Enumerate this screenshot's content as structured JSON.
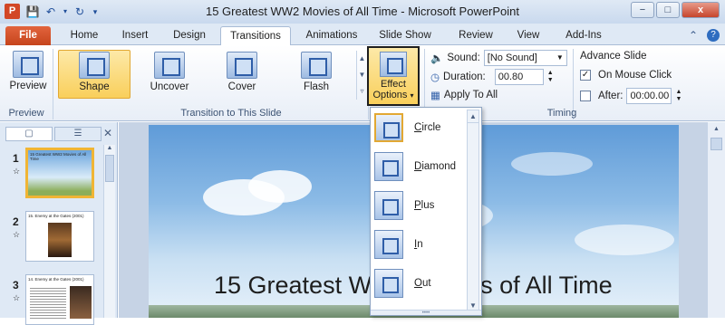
{
  "window": {
    "title": "15 Greatest WW2 Movies of All Time - Microsoft PowerPoint",
    "app_icon_letter": "P",
    "minimize": "−",
    "maximize": "□",
    "close": "x"
  },
  "tabs": [
    {
      "label": "File"
    },
    {
      "label": "Home"
    },
    {
      "label": "Insert"
    },
    {
      "label": "Design"
    },
    {
      "label": "Transitions"
    },
    {
      "label": "Animations"
    },
    {
      "label": "Slide Show"
    },
    {
      "label": "Review"
    },
    {
      "label": "View"
    },
    {
      "label": "Add-Ins"
    }
  ],
  "ribbon": {
    "preview": {
      "button": "Preview",
      "group": "Preview"
    },
    "transitions": {
      "group": "Transition to This Slide",
      "items": [
        {
          "label": "Shape",
          "selected": true
        },
        {
          "label": "Uncover"
        },
        {
          "label": "Cover"
        },
        {
          "label": "Flash"
        }
      ]
    },
    "effect_options": {
      "line1": "Effect",
      "line2": "Options",
      "arrow": "▾"
    },
    "timing": {
      "group": "Timing",
      "sound_label": "Sound:",
      "sound_value": "[No Sound]",
      "duration_label": "Duration:",
      "duration_value": "00.80",
      "apply_all": "Apply To All",
      "advance_title": "Advance Slide",
      "on_mouse_click": "On Mouse Click",
      "on_mouse_click_checked": true,
      "after_label": "After:",
      "after_value": "00:00.00",
      "after_checked": false
    }
  },
  "slides_panel": {
    "thumbnails": [
      {
        "number": "1",
        "text": "15 Greatest WW2 Movies of All Time",
        "selected": true
      },
      {
        "number": "2",
        "text": "15. Enemy at the Gates (2001)"
      },
      {
        "number": "3",
        "text": "14. Enemy at the Gates (2001)"
      }
    ]
  },
  "slide": {
    "title": "15 Greatest WW2 Movies of All Time"
  },
  "effect_menu": {
    "items": [
      {
        "label": "Circle",
        "selected": true
      },
      {
        "label": "Diamond"
      },
      {
        "label": "Plus"
      },
      {
        "label": "In"
      },
      {
        "label": "Out"
      }
    ]
  },
  "colors": {
    "accent_file_tab": "#d24726",
    "selection_gold": "#f9cf5b",
    "ribbon_blue": "#dfe9f5"
  }
}
